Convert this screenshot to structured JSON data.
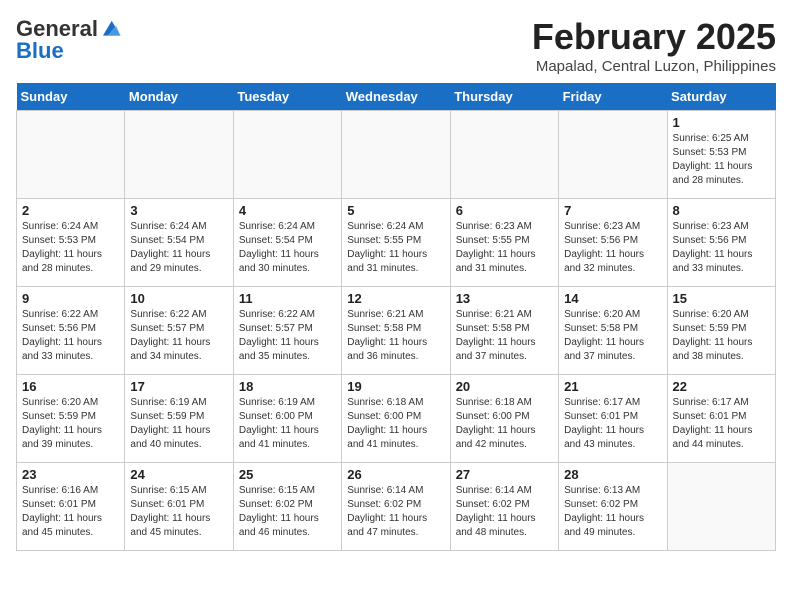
{
  "header": {
    "logo_general": "General",
    "logo_blue": "Blue",
    "month_title": "February 2025",
    "location": "Mapalad, Central Luzon, Philippines"
  },
  "days_of_week": [
    "Sunday",
    "Monday",
    "Tuesday",
    "Wednesday",
    "Thursday",
    "Friday",
    "Saturday"
  ],
  "weeks": [
    [
      {
        "num": "",
        "info": ""
      },
      {
        "num": "",
        "info": ""
      },
      {
        "num": "",
        "info": ""
      },
      {
        "num": "",
        "info": ""
      },
      {
        "num": "",
        "info": ""
      },
      {
        "num": "",
        "info": ""
      },
      {
        "num": "1",
        "info": "Sunrise: 6:25 AM\nSunset: 5:53 PM\nDaylight: 11 hours and 28 minutes."
      }
    ],
    [
      {
        "num": "2",
        "info": "Sunrise: 6:24 AM\nSunset: 5:53 PM\nDaylight: 11 hours and 28 minutes."
      },
      {
        "num": "3",
        "info": "Sunrise: 6:24 AM\nSunset: 5:54 PM\nDaylight: 11 hours and 29 minutes."
      },
      {
        "num": "4",
        "info": "Sunrise: 6:24 AM\nSunset: 5:54 PM\nDaylight: 11 hours and 30 minutes."
      },
      {
        "num": "5",
        "info": "Sunrise: 6:24 AM\nSunset: 5:55 PM\nDaylight: 11 hours and 31 minutes."
      },
      {
        "num": "6",
        "info": "Sunrise: 6:23 AM\nSunset: 5:55 PM\nDaylight: 11 hours and 31 minutes."
      },
      {
        "num": "7",
        "info": "Sunrise: 6:23 AM\nSunset: 5:56 PM\nDaylight: 11 hours and 32 minutes."
      },
      {
        "num": "8",
        "info": "Sunrise: 6:23 AM\nSunset: 5:56 PM\nDaylight: 11 hours and 33 minutes."
      }
    ],
    [
      {
        "num": "9",
        "info": "Sunrise: 6:22 AM\nSunset: 5:56 PM\nDaylight: 11 hours and 33 minutes."
      },
      {
        "num": "10",
        "info": "Sunrise: 6:22 AM\nSunset: 5:57 PM\nDaylight: 11 hours and 34 minutes."
      },
      {
        "num": "11",
        "info": "Sunrise: 6:22 AM\nSunset: 5:57 PM\nDaylight: 11 hours and 35 minutes."
      },
      {
        "num": "12",
        "info": "Sunrise: 6:21 AM\nSunset: 5:58 PM\nDaylight: 11 hours and 36 minutes."
      },
      {
        "num": "13",
        "info": "Sunrise: 6:21 AM\nSunset: 5:58 PM\nDaylight: 11 hours and 37 minutes."
      },
      {
        "num": "14",
        "info": "Sunrise: 6:20 AM\nSunset: 5:58 PM\nDaylight: 11 hours and 37 minutes."
      },
      {
        "num": "15",
        "info": "Sunrise: 6:20 AM\nSunset: 5:59 PM\nDaylight: 11 hours and 38 minutes."
      }
    ],
    [
      {
        "num": "16",
        "info": "Sunrise: 6:20 AM\nSunset: 5:59 PM\nDaylight: 11 hours and 39 minutes."
      },
      {
        "num": "17",
        "info": "Sunrise: 6:19 AM\nSunset: 5:59 PM\nDaylight: 11 hours and 40 minutes."
      },
      {
        "num": "18",
        "info": "Sunrise: 6:19 AM\nSunset: 6:00 PM\nDaylight: 11 hours and 41 minutes."
      },
      {
        "num": "19",
        "info": "Sunrise: 6:18 AM\nSunset: 6:00 PM\nDaylight: 11 hours and 41 minutes."
      },
      {
        "num": "20",
        "info": "Sunrise: 6:18 AM\nSunset: 6:00 PM\nDaylight: 11 hours and 42 minutes."
      },
      {
        "num": "21",
        "info": "Sunrise: 6:17 AM\nSunset: 6:01 PM\nDaylight: 11 hours and 43 minutes."
      },
      {
        "num": "22",
        "info": "Sunrise: 6:17 AM\nSunset: 6:01 PM\nDaylight: 11 hours and 44 minutes."
      }
    ],
    [
      {
        "num": "23",
        "info": "Sunrise: 6:16 AM\nSunset: 6:01 PM\nDaylight: 11 hours and 45 minutes."
      },
      {
        "num": "24",
        "info": "Sunrise: 6:15 AM\nSunset: 6:01 PM\nDaylight: 11 hours and 45 minutes."
      },
      {
        "num": "25",
        "info": "Sunrise: 6:15 AM\nSunset: 6:02 PM\nDaylight: 11 hours and 46 minutes."
      },
      {
        "num": "26",
        "info": "Sunrise: 6:14 AM\nSunset: 6:02 PM\nDaylight: 11 hours and 47 minutes."
      },
      {
        "num": "27",
        "info": "Sunrise: 6:14 AM\nSunset: 6:02 PM\nDaylight: 11 hours and 48 minutes."
      },
      {
        "num": "28",
        "info": "Sunrise: 6:13 AM\nSunset: 6:02 PM\nDaylight: 11 hours and 49 minutes."
      },
      {
        "num": "",
        "info": ""
      }
    ]
  ]
}
